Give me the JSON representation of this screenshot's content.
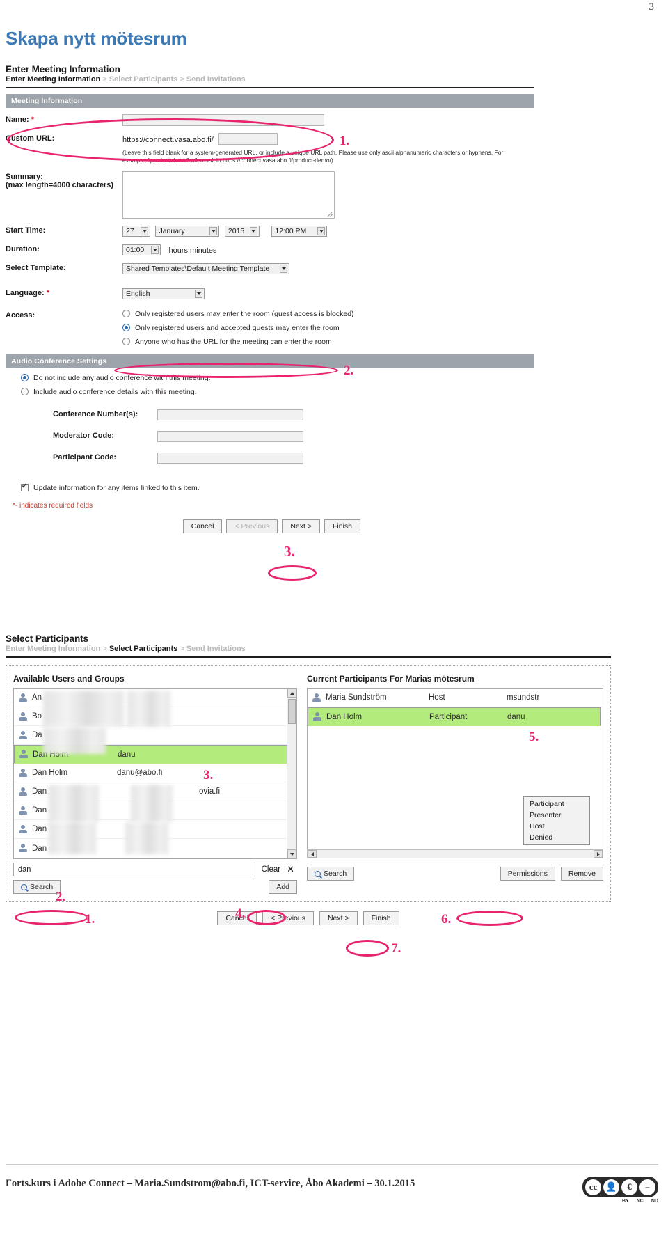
{
  "page": {
    "number": "3",
    "title": "Skapa nytt mötesrum"
  },
  "wizard1": {
    "heading": "Enter Meeting Information",
    "breadcrumb": {
      "current": "Enter Meeting Information",
      "s1": ">",
      "step2": "Select Participants",
      "s2": ">",
      "step3": "Send Invitations"
    },
    "section_meeting": "Meeting Information",
    "labels": {
      "name": "Name:",
      "custom_url": "Custom URL:",
      "summary": "Summary:",
      "summary_sub": "(max length=4000 characters)",
      "start_time": "Start Time:",
      "duration": "Duration:",
      "select_template": "Select Template:",
      "language": "Language:",
      "access": "Access:"
    },
    "required_mark": "*",
    "url_prefix": "https://connect.vasa.abo.fi/",
    "url_hint": "(Leave this field blank for a system-generated URL, or include a unique URL path. Please use only ascii alphanumeric characters or hyphens. For example: \"product-demo\" will result in https://connect.vasa.abo.fi/product-demo/)",
    "start_time": {
      "day": "27",
      "month": "January",
      "year": "2015",
      "time": "12:00 PM"
    },
    "duration": {
      "value": "01:00",
      "unit": "hours:minutes"
    },
    "template": "Shared Templates\\Default Meeting Template",
    "language": "English",
    "access_options": [
      {
        "label": "Only registered users may enter the room (guest access is blocked)",
        "selected": false
      },
      {
        "label": "Only registered users and accepted guests may enter the room",
        "selected": true
      },
      {
        "label": "Anyone who has the URL for the meeting can enter the room",
        "selected": false
      }
    ],
    "section_audio": "Audio Conference Settings",
    "audio_options": [
      {
        "label": "Do not include any audio conference with this meeting.",
        "selected": true
      },
      {
        "label": "Include audio conference details with this meeting.",
        "selected": false
      }
    ],
    "audio_fields": [
      {
        "label": "Conference Number(s):"
      },
      {
        "label": "Moderator Code:"
      },
      {
        "label": "Participant Code:"
      }
    ],
    "update_checkbox": {
      "label": "Update information for any items linked to this item.",
      "checked": true
    },
    "required_note": "*- indicates required fields",
    "buttons": {
      "cancel": "Cancel",
      "previous": "< Previous",
      "next": "Next >",
      "finish": "Finish"
    }
  },
  "wizard2": {
    "heading": "Select Participants",
    "breadcrumb": {
      "step1": "Enter Meeting Information",
      "s1": ">",
      "current": "Select Participants",
      "s2": ">",
      "step3": "Send Invitations"
    },
    "available_title": "Available Users and Groups",
    "current_title": "Current Participants For Marias mötesrum",
    "available_users": [
      {
        "name": "An",
        "login": "",
        "blurred": true
      },
      {
        "name": "Bo",
        "login": "",
        "blurred": true
      },
      {
        "name": "Da",
        "login": "",
        "blurred": true
      },
      {
        "name": "Dan Holm",
        "login": "danu",
        "blurred": false,
        "selected": true
      },
      {
        "name": "Dan Holm",
        "login": "danu@abo.fi",
        "blurred": true
      },
      {
        "name": "Dan",
        "login": "ovia.fi",
        "blurred": true
      },
      {
        "name": "Dan",
        "login": "",
        "blurred": true
      },
      {
        "name": "Dan",
        "login": "",
        "blurred": true
      },
      {
        "name": "Dan",
        "login": "",
        "blurred": true
      }
    ],
    "current_participants": [
      {
        "name": "Maria Sundström",
        "role": "Host",
        "login": "msundstr",
        "selected": false
      },
      {
        "name": "Dan Holm",
        "role": "Participant",
        "login": "danu",
        "selected": true
      }
    ],
    "search_value": "dan",
    "clear_label": "Clear",
    "x_label": "✕",
    "search_label": "Search",
    "add_label": "Add",
    "search2_label": "Search",
    "permissions_label": "Permissions",
    "remove_label": "Remove",
    "permissions_menu": [
      "Participant",
      "Presenter",
      "Host",
      "Denied"
    ],
    "buttons": {
      "cancel": "Cancel",
      "previous": "< Previous",
      "next": "Next >",
      "finish": "Finish"
    }
  },
  "annotations": [
    {
      "id": "a1",
      "text": "1."
    },
    {
      "id": "a2",
      "text": "2."
    },
    {
      "id": "a3",
      "text": "3."
    },
    {
      "id": "b1",
      "text": "1."
    },
    {
      "id": "b2",
      "text": "2."
    },
    {
      "id": "b3",
      "text": "3."
    },
    {
      "id": "b4",
      "text": "4."
    },
    {
      "id": "b5",
      "text": "5."
    },
    {
      "id": "b6",
      "text": "6."
    },
    {
      "id": "b7",
      "text": "7."
    }
  ],
  "footer": {
    "text": "Forts.kurs i Adobe Connect – Maria.Sundstrom@abo.fi, ICT-service, Åbo Akademi – 30.1.2015",
    "cc": {
      "main": "cc",
      "by": "BY",
      "nc": "NC",
      "nd": "ND"
    }
  },
  "colors": {
    "accent": "#e8246e",
    "title": "#3d7ab5",
    "section_header": "#9ea4ab",
    "selected_row": "#b4eb7d"
  }
}
